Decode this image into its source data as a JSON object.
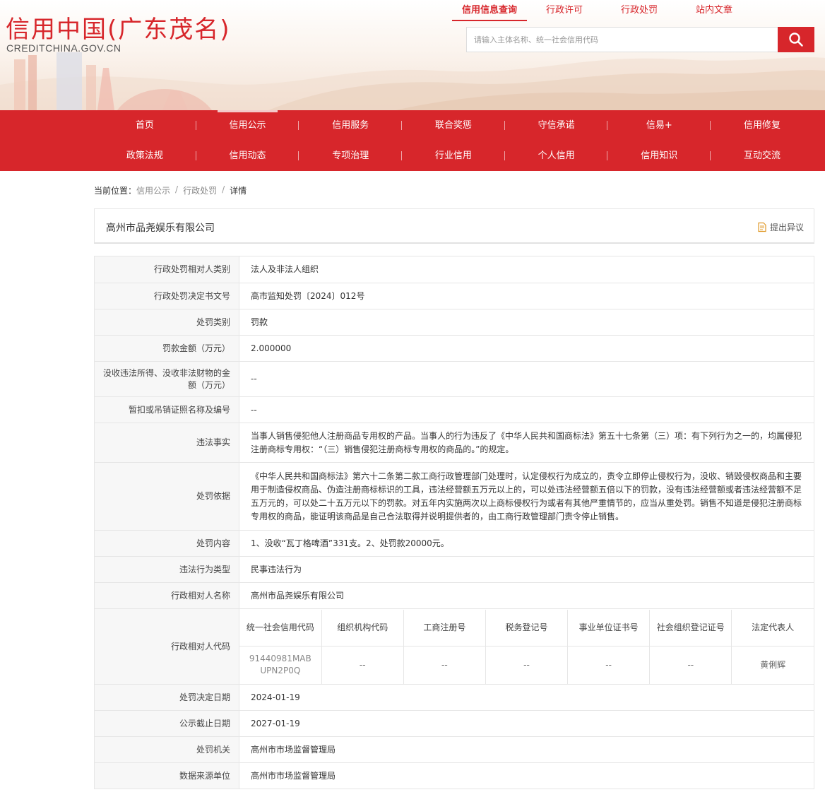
{
  "header": {
    "logo_cn": "信用中国(广东茂名)",
    "logo_en": "CREDITCHINA.GOV.CN",
    "top_links": [
      {
        "label": "信用信息查询",
        "active": true
      },
      {
        "label": "行政许可",
        "active": false
      },
      {
        "label": "行政处罚",
        "active": false
      },
      {
        "label": "站内文章",
        "active": false
      }
    ],
    "search": {
      "placeholder": "请输入主体名称、统一社会信用代码",
      "value": ""
    }
  },
  "nav": {
    "row1": [
      "首页",
      "信用公示",
      "信用服务",
      "联合奖惩",
      "守信承诺",
      "信易+",
      "信用修复"
    ],
    "row2": [
      "政策法规",
      "信用动态",
      "专项治理",
      "行业信用",
      "个人信用",
      "信用知识",
      "互动交流"
    ],
    "active": "信用公示"
  },
  "breadcrumb": {
    "prefix": "当前位置：",
    "items": [
      "信用公示",
      "行政处罚",
      "详情"
    ]
  },
  "title_box": {
    "company": "高州市品尧娱乐有限公司",
    "objection_label": "提出异议"
  },
  "details": {
    "party_type": {
      "label": "行政处罚相对人类别",
      "value": "法人及非法人组织"
    },
    "decision_no": {
      "label": "行政处罚决定书文号",
      "value": "高市监知处罚〔2024〕012号"
    },
    "category": {
      "label": "处罚类别",
      "value": "罚款"
    },
    "fine": {
      "label": "罚款金额（万元）",
      "value": "2.000000"
    },
    "confiscation": {
      "label": "没收违法所得、没收非法财物的金额（万元）",
      "value": "--"
    },
    "license": {
      "label": "暂扣或吊销证照名称及编号",
      "value": "--"
    },
    "facts": {
      "label": "违法事实",
      "value": "当事人销售侵犯他人注册商品专用权的产品。当事人的行为违反了《中华人民共和国商标法》第五十七条第（三）项：有下列行为之一的，均属侵犯注册商标专用权：“（三）销售侵犯注册商标专用权的商品的。”的规定。"
    },
    "basis": {
      "label": "处罚依据",
      "value": "《中华人民共和国商标法》第六十二条第二款工商行政管理部门处理时，认定侵权行为成立的，责令立即停止侵权行为，没收、销毁侵权商品和主要用于制造侵权商品、伪造注册商标标识的工具，违法经营额五万元以上的，可以处违法经营额五倍以下的罚款，没有违法经营额或者违法经营额不足五万元的，可以处二十五万元以下的罚款。对五年内实施两次以上商标侵权行为或者有其他严重情节的，应当从重处罚。销售不知道是侵犯注册商标专用权的商品，能证明该商品是自己合法取得并说明提供者的，由工商行政管理部门责令停止销售。"
    },
    "content": {
      "label": "处罚内容",
      "value": "1、没收“瓦丁格啤酒”331支。2、处罚款20000元。"
    },
    "behavior_type": {
      "label": "违法行为类型",
      "value": "民事违法行为"
    },
    "party_name": {
      "label": "行政相对人名称",
      "value": "高州市品尧娱乐有限公司"
    },
    "party_code": {
      "label": "行政相对人代码",
      "headers": [
        "统一社会信用代码",
        "组织机构代码",
        "工商注册号",
        "税务登记号",
        "事业单位证书号",
        "社会组织登记证号",
        "法定代表人"
      ],
      "values": [
        "91440981MAB UPN2P0Q",
        "--",
        "--",
        "--",
        "--",
        "--",
        "黄俐辉"
      ]
    },
    "decision_date": {
      "label": "处罚决定日期",
      "value": "2024-01-19"
    },
    "deadline": {
      "label": "公示截止日期",
      "value": "2027-01-19"
    },
    "authority": {
      "label": "处罚机关",
      "value": "高州市市场监督管理局"
    },
    "source": {
      "label": "数据来源单位",
      "value": "高州市市场监督管理局"
    }
  }
}
